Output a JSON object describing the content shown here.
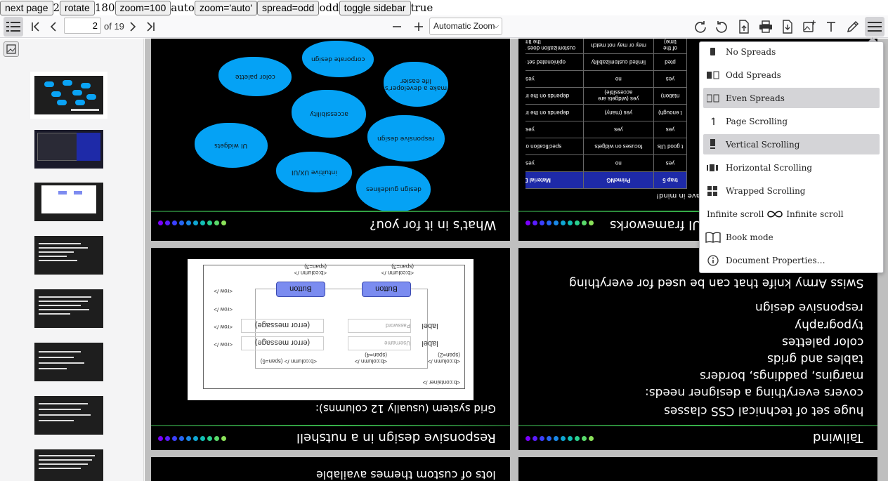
{
  "controls": {
    "next_page": "next page",
    "page_value": "2",
    "rotate": "rotate",
    "rotation_value": "180",
    "zoom100": "zoom=100",
    "zoom_value": "auto",
    "zoom_auto": "zoom='auto'",
    "spread_odd": "spread=odd",
    "spread_value": "odd",
    "toggle_sidebar": "toggle sidebar",
    "sidebar_value": "true"
  },
  "toolbar": {
    "page_number": "2",
    "page_count": "of 19",
    "zoom_label": "Automatic Zoom",
    "zoom_chevron": "⌵"
  },
  "menu": {
    "items": [
      {
        "label": "No Spreads",
        "icon": "no-spreads-icon",
        "selected": false
      },
      {
        "label": "Odd Spreads",
        "icon": "odd-spreads-icon",
        "selected": false
      },
      {
        "label": "Even Spreads",
        "icon": "even-spreads-icon",
        "selected": true
      },
      {
        "label": "Page Scrolling",
        "icon": "page-scrolling-icon",
        "selected": false
      },
      {
        "label": "Vertical Scrolling",
        "icon": "vertical-scrolling-icon",
        "selected": true
      },
      {
        "label": "Horizontal Scrolling",
        "icon": "horizontal-scrolling-icon",
        "selected": false
      },
      {
        "label": "Wrapped Scrolling",
        "icon": "wrapped-scrolling-icon",
        "selected": false
      },
      {
        "label": "Infinite scroll",
        "icon": "infinite-scroll-icon",
        "selected": false
      },
      {
        "label": "Book mode",
        "icon": "book-icon",
        "selected": false
      },
      {
        "label": "Document Properties…",
        "icon": "info-icon",
        "selected": false
      }
    ],
    "infinite_scroll_prefix": "Infinite scroll"
  },
  "slides": {
    "s1": {
      "title": "What's in it for you?",
      "clouds": [
        "color palette",
        "corporate design",
        "make a developer's life easier",
        "accessibility",
        "UI widgets",
        "responsive design",
        "intuitive UX/UI",
        "design guidelines"
      ]
    },
    "s2": {
      "title": "UI frameworks",
      "caption": "have in mind!",
      "headers": [
        "trap 5",
        "PrimeNG",
        "Material Design"
      ],
      "rows": [
        [
          "yes",
          "no",
          "yes"
        ],
        [
          "t good UIs",
          "focuses on widgets",
          "specification of a good UI"
        ],
        [
          "yes",
          "yes",
          "yes"
        ],
        [
          "t enough)",
          "yes (many)",
          "depends on the implementation"
        ],
        [
          "ntation)",
          "yes (widgets are accessible)",
          "depends on the implementation"
        ],
        [
          "yes",
          "no",
          "yes"
        ],
        [
          "pted",
          "limited customizability",
          "opinionated set of guidelines"
        ],
        [
          "of the time)",
          "may or may not match",
          "customization does the trick (most of the time)"
        ]
      ]
    },
    "s3": {
      "title": "Responsive design in a nutshell",
      "subtitle": "Grid system (usually 12 columns):",
      "buttons": [
        "Button",
        "Button"
      ],
      "labels": [
        "label",
        "label"
      ],
      "fields": [
        "Username",
        "Password"
      ],
      "errors": [
        "(error message)",
        "(error message)"
      ],
      "rows": [
        "<row />",
        "<row />",
        "<row />",
        "<row />"
      ],
      "cols_top": [
        "<b:column /> (span=3)",
        "<b:column /> (span=3)"
      ],
      "cols_bottom": [
        "<b:column /> (span=2)",
        "<b:column /> (span=4)",
        "<b:column /> (span=6)"
      ],
      "container": "<b:container />"
    },
    "s4": {
      "title": "Tailwind",
      "bullets": [
        "huge set of technical CSS classes",
        "covers everything a designer needs:",
        "margins, paddings, borders",
        "tables and grids",
        "color palettes",
        "typography",
        "responsive design",
        "Swiss Army knife that can be used for everything"
      ]
    },
    "s5": {
      "bullet": "lots of custom themes available"
    }
  },
  "colors": {
    "accent_cloud": "#05a2f5",
    "menu_selected": "#d4d4d7",
    "table_header": "#1e2aa8"
  }
}
